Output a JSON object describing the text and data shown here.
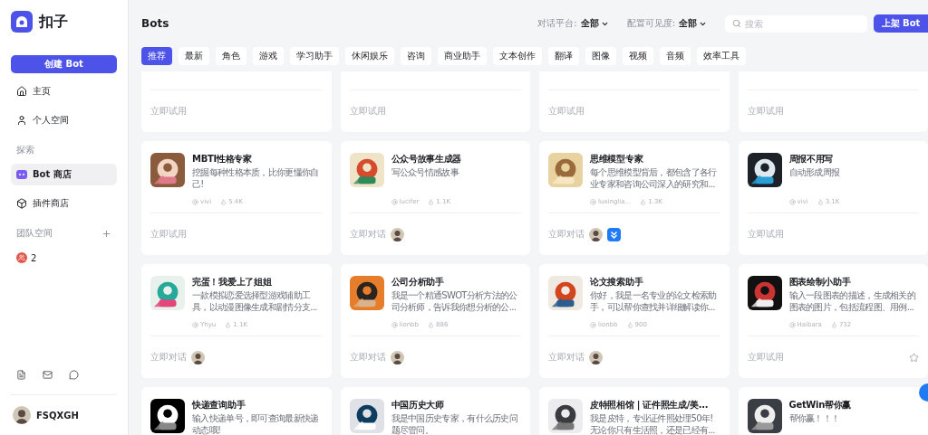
{
  "app": {
    "name": "扣子"
  },
  "sidebar": {
    "create_button": "创建 Bot",
    "nav": [
      {
        "label": "主页",
        "selected": false
      },
      {
        "label": "个人空间",
        "selected": false
      }
    ],
    "explore_heading": "探索",
    "explore": [
      {
        "label": "Bot 商店",
        "selected": true
      },
      {
        "label": "插件商店",
        "selected": false
      }
    ],
    "team_heading": "团队空间",
    "teams": [
      {
        "label": "2"
      }
    ],
    "user": {
      "name": "FSQXGH"
    }
  },
  "header": {
    "title": "Bots",
    "filters": [
      {
        "label": "对话平台:",
        "value": "全部"
      },
      {
        "label": "配置可见度:",
        "value": "全部"
      }
    ],
    "search": {
      "placeholder": "搜索"
    },
    "publish_button": "上架 Bot"
  },
  "categories": [
    {
      "label": "推荐",
      "selected": true
    },
    {
      "label": "最新",
      "selected": false
    },
    {
      "label": "角色",
      "selected": false
    },
    {
      "label": "游戏",
      "selected": false
    },
    {
      "label": "学习助手",
      "selected": false
    },
    {
      "label": "休闲娱乐",
      "selected": false
    },
    {
      "label": "咨询",
      "selected": false
    },
    {
      "label": "商业助手",
      "selected": false
    },
    {
      "label": "文本创作",
      "selected": false
    },
    {
      "label": "翻译",
      "selected": false
    },
    {
      "label": "图像",
      "selected": false
    },
    {
      "label": "视频",
      "selected": false
    },
    {
      "label": "音频",
      "selected": false
    },
    {
      "label": "效率工具",
      "selected": false
    }
  ],
  "cards": [
    {
      "kind": "partial",
      "action": "立即试用"
    },
    {
      "kind": "partial",
      "action": "立即试用"
    },
    {
      "kind": "partial",
      "action": "立即试用"
    },
    {
      "kind": "partial",
      "action": "立即试用"
    },
    {
      "kind": "full",
      "title": "MBTI性格专家",
      "description": "挖掘每种性格本质，比你更懂你自己!",
      "author": "vivi",
      "likes": "5.4K",
      "action": "立即试用"
    },
    {
      "kind": "full",
      "title": "公众号故事生成器",
      "description": "写公众号情感故事",
      "author": "lucifer",
      "likes": "1.1K",
      "action": "立即对话",
      "footer_icons": [
        {
          "kind": "avatar"
        }
      ]
    },
    {
      "kind": "full",
      "title": "思维模型专家",
      "description": "每个思维模型背后，都包含了各行业专家和咨询公司深入的研究和...",
      "author": "luxinglia...",
      "likes": "1.3K",
      "action": "立即对话",
      "footer_icons": [
        {
          "kind": "avatar"
        },
        {
          "kind": "app"
        }
      ]
    },
    {
      "kind": "full",
      "title": "周报不用写",
      "description": "自动形成周报",
      "author": "vivi",
      "likes": "3.1K",
      "action": "立即试用"
    },
    {
      "kind": "full",
      "title": "完蛋！我爱上了姐姐",
      "description": "一款模拟恋爱选择型游戏辅助工具，以动漫图像生成和剧情分支...",
      "author": "Yhyu",
      "likes": "1.1K",
      "action": "立即对话",
      "footer_icons": [
        {
          "kind": "avatar"
        }
      ]
    },
    {
      "kind": "full",
      "title": "公司分析助手",
      "description": "我是一个精通SWOT分析方法的公司分析师，告诉我你想分析的公...",
      "author": "lionbb",
      "likes": "886",
      "action": "立即对话",
      "footer_icons": [
        {
          "kind": "avatar"
        }
      ]
    },
    {
      "kind": "full",
      "title": "论文搜索助手",
      "description": "你好，我是一名专业的论文检索助手，可以帮你查找并详细解读你...",
      "author": "lionbb",
      "likes": "900",
      "action": "立即对话",
      "footer_icons": [
        {
          "kind": "avatar"
        }
      ]
    },
    {
      "kind": "full",
      "title": "图表绘制小助手",
      "description": "输入一段图表的描述，生成相关的图表的图片，包括流程图、用例...",
      "author": "Haibara",
      "likes": "732",
      "action": "立即试用",
      "footer_icons": [
        {
          "kind": "star"
        }
      ]
    },
    {
      "kind": "full",
      "title": "快递查询助手",
      "description": "输入快递单号，即可查询最新快递动态哦!"
    },
    {
      "kind": "full",
      "title": "中国历史大师",
      "description": "我是中国历史专家，有什么历史问题尽管问。"
    },
    {
      "kind": "full",
      "title": "皮特照相馆 | 证件照生成/美...",
      "description": "我是皮特，专业证件照处理50年! 无论你只有生活照，还是已经有..."
    },
    {
      "kind": "full",
      "title": "GetWin帮你赢",
      "description": "帮你赢！！！"
    }
  ]
}
